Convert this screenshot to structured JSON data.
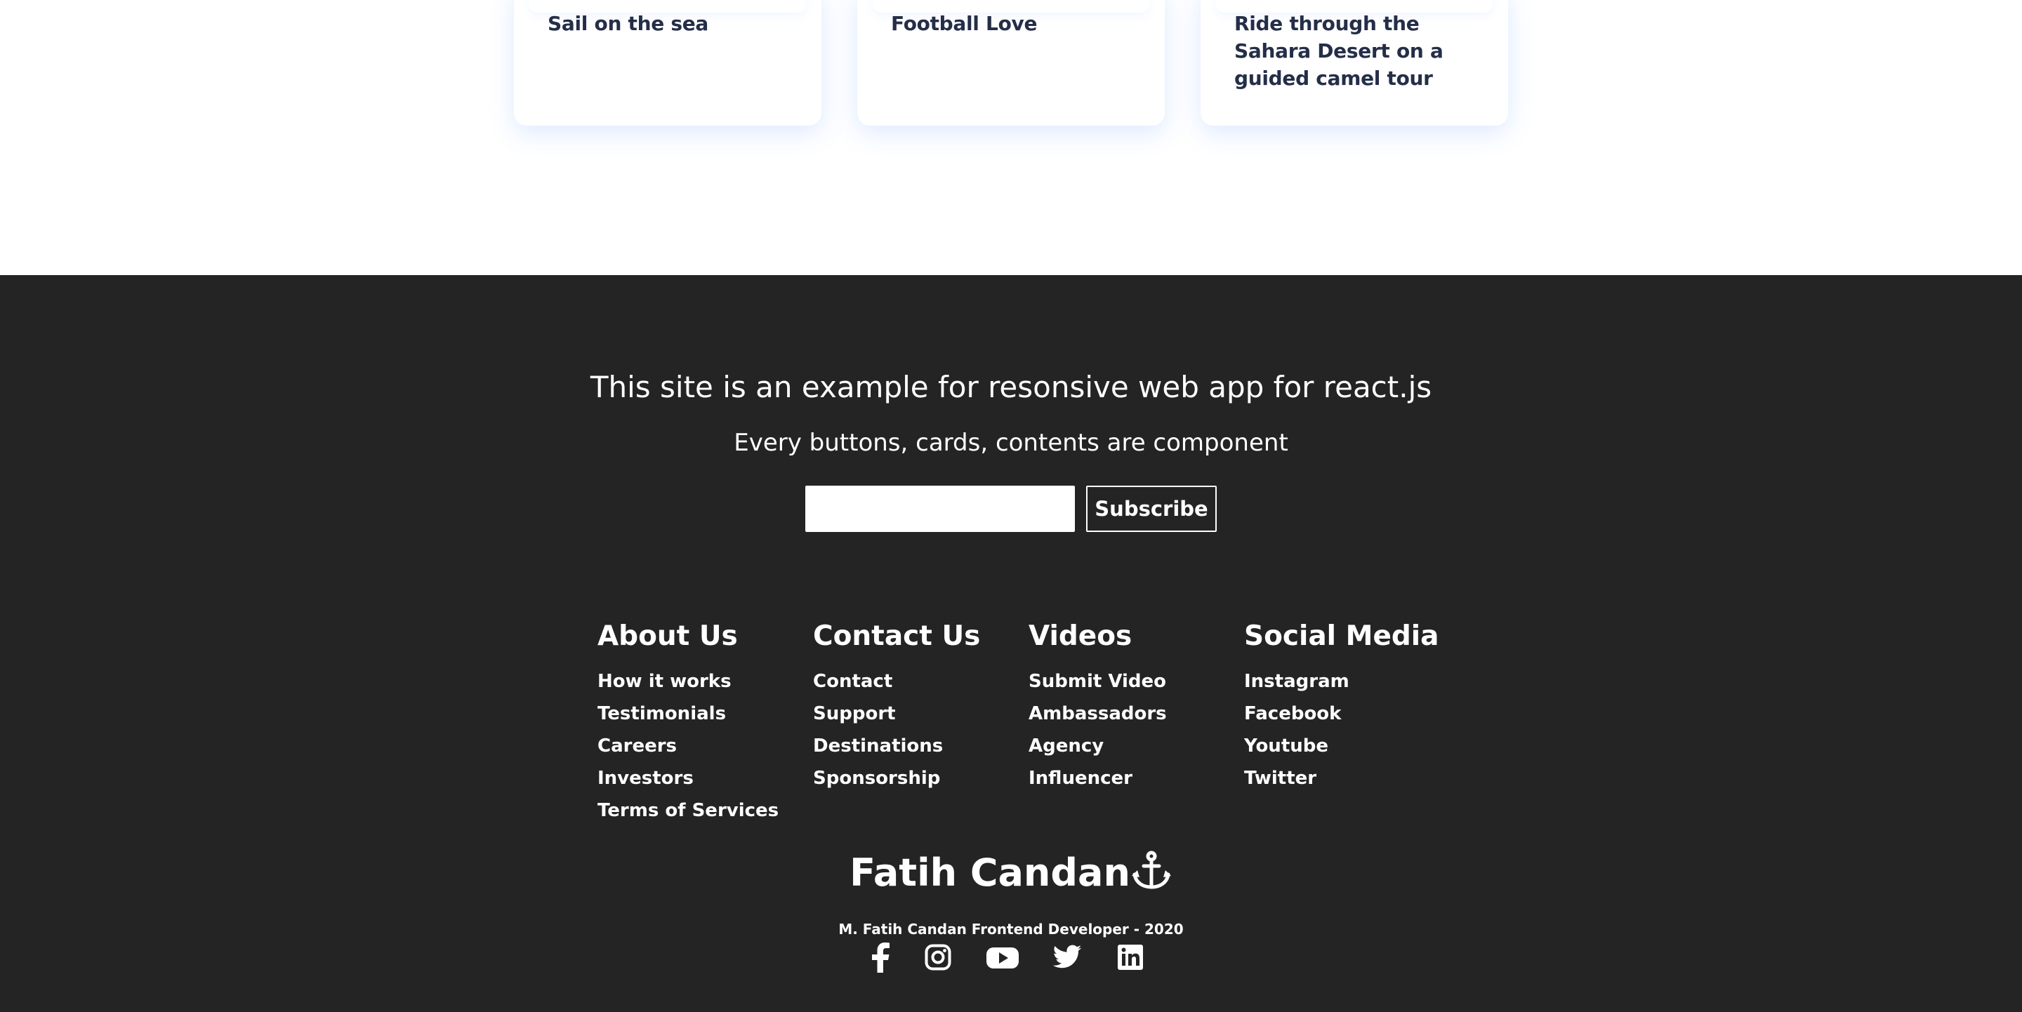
{
  "cards": [
    {
      "label": "Sail on the sea"
    },
    {
      "label": "Football Love"
    },
    {
      "label": "Ride through the Sahara Desert on a guided camel tour"
    }
  ],
  "subscription": {
    "heading": "This site is an example for resonsive web app for react.js",
    "text": "Every buttons, cards, contents are component",
    "input_placeholder": "",
    "button_label": "Subscribe"
  },
  "footer_links": [
    {
      "title": "About Us",
      "links": [
        "How it works",
        "Testimonials",
        "Careers",
        "Investors",
        "Terms of Services"
      ]
    },
    {
      "title": "Contact Us",
      "links": [
        "Contact",
        "Support",
        "Destinations",
        "Sponsorship"
      ]
    },
    {
      "title": "Videos",
      "links": [
        "Submit Video",
        "Ambassadors",
        "Agency",
        "Influencer"
      ]
    },
    {
      "title": "Social Media",
      "links": [
        "Instagram",
        "Facebook",
        "Youtube",
        "Twitter"
      ]
    }
  ],
  "brand": {
    "name": "Fatih Candan",
    "icon": "anchor-icon"
  },
  "copyright": "M. Fatih Candan Frontend Developer - 2020",
  "social_icons": [
    "facebook-icon",
    "instagram-icon",
    "youtube-icon",
    "twitter-icon",
    "linkedin-icon"
  ],
  "colors": {
    "footer_background": "#242424",
    "card_text": "#252e48",
    "text_light": "#ffffff"
  }
}
